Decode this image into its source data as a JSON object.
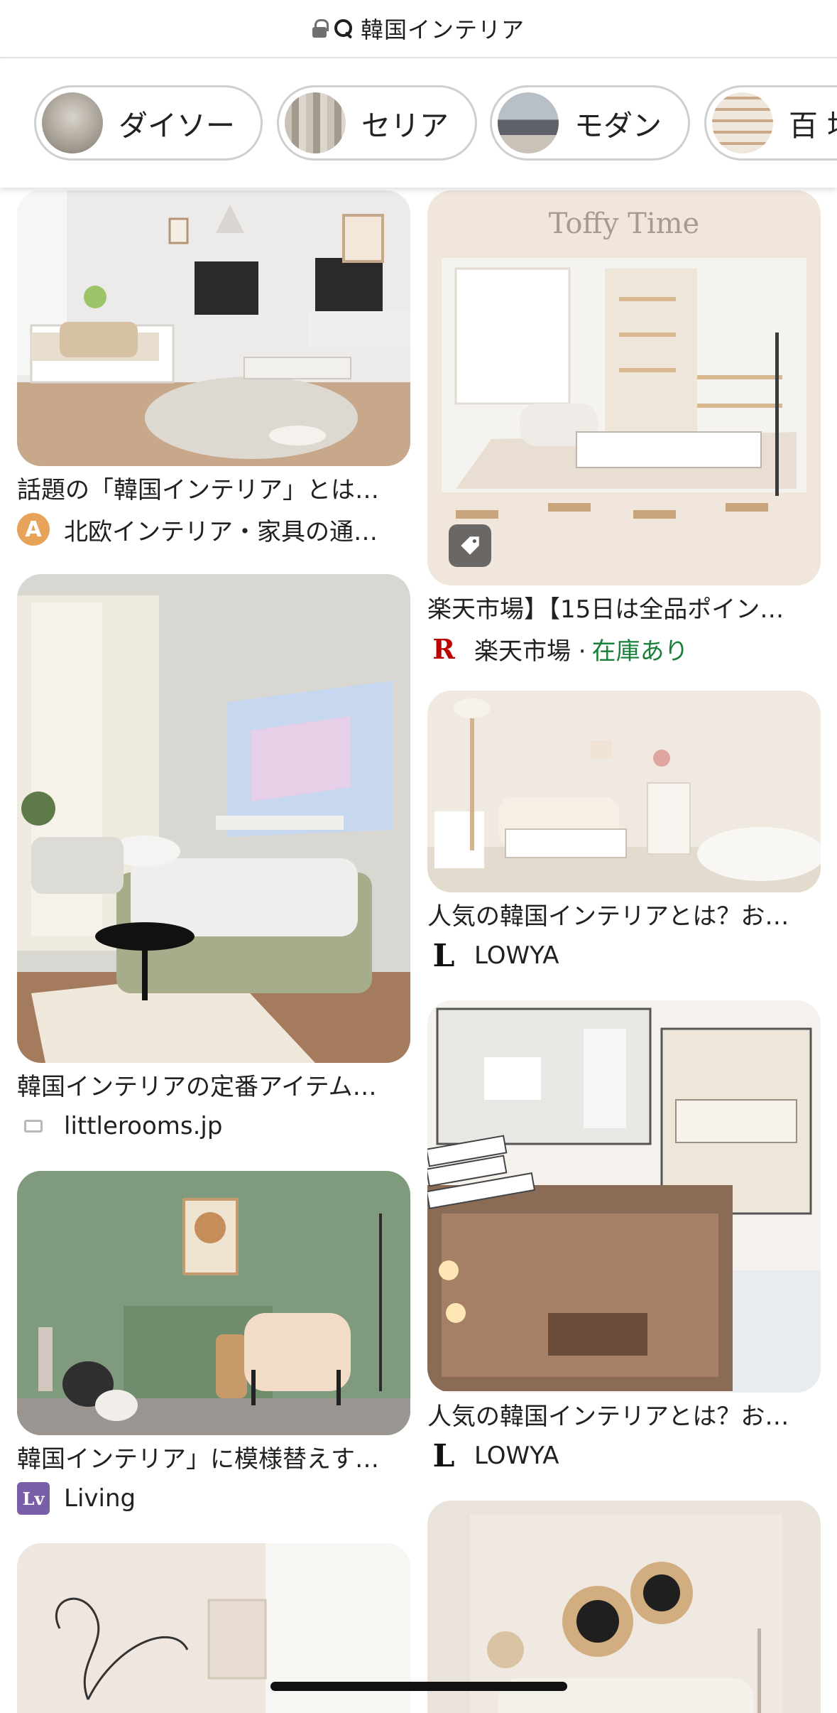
{
  "search": {
    "query": "韓国インテリア"
  },
  "chips": [
    {
      "label": "ダイソー"
    },
    {
      "label": "セリア"
    },
    {
      "label": "モダン"
    },
    {
      "label": "百 均"
    }
  ],
  "results": {
    "left": [
      {
        "title": "話題の「韓国インテリア」とは…",
        "favicon": "A",
        "source": "北欧インテリア・家具の通…"
      },
      {
        "title": "韓国インテリアの定番アイテム…",
        "favicon": "",
        "source": "littlerooms.jp"
      },
      {
        "title": "韓国インテリア」に模様替えす…",
        "favicon": "Lv",
        "source": "Living"
      },
      {
        "title": "",
        "favicon": "",
        "source": ""
      }
    ],
    "right": [
      {
        "title": "楽天市場】【15日は全品ポイン…",
        "favicon": "R",
        "source": "楽天市場 ·",
        "stock": "在庫あり",
        "image_text": "Toffy Time"
      },
      {
        "title": "人気の韓国インテリアとは？お…",
        "favicon": "L",
        "source": "LOWYA"
      },
      {
        "title": "人気の韓国インテリアとは？お…",
        "favicon": "L",
        "source": "LOWYA"
      },
      {
        "title": "",
        "favicon": "",
        "source": ""
      }
    ]
  },
  "icons": {
    "lock": "lock-icon",
    "search": "search-icon",
    "tag": "tag-icon"
  },
  "colors": {
    "stock_green": "#188038",
    "rakuten_red": "#bf0000",
    "chip_border": "#cfcfcf"
  }
}
